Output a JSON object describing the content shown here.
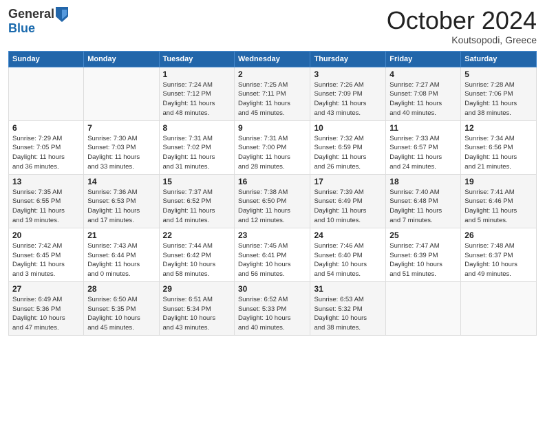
{
  "header": {
    "logo_line1": "General",
    "logo_line2": "Blue",
    "month_title": "October 2024",
    "location": "Koutsopodi, Greece"
  },
  "days_of_week": [
    "Sunday",
    "Monday",
    "Tuesday",
    "Wednesday",
    "Thursday",
    "Friday",
    "Saturday"
  ],
  "weeks": [
    [
      {
        "day": "",
        "info": ""
      },
      {
        "day": "",
        "info": ""
      },
      {
        "day": "1",
        "info": "Sunrise: 7:24 AM\nSunset: 7:12 PM\nDaylight: 11 hours\nand 48 minutes."
      },
      {
        "day": "2",
        "info": "Sunrise: 7:25 AM\nSunset: 7:11 PM\nDaylight: 11 hours\nand 45 minutes."
      },
      {
        "day": "3",
        "info": "Sunrise: 7:26 AM\nSunset: 7:09 PM\nDaylight: 11 hours\nand 43 minutes."
      },
      {
        "day": "4",
        "info": "Sunrise: 7:27 AM\nSunset: 7:08 PM\nDaylight: 11 hours\nand 40 minutes."
      },
      {
        "day": "5",
        "info": "Sunrise: 7:28 AM\nSunset: 7:06 PM\nDaylight: 11 hours\nand 38 minutes."
      }
    ],
    [
      {
        "day": "6",
        "info": "Sunrise: 7:29 AM\nSunset: 7:05 PM\nDaylight: 11 hours\nand 36 minutes."
      },
      {
        "day": "7",
        "info": "Sunrise: 7:30 AM\nSunset: 7:03 PM\nDaylight: 11 hours\nand 33 minutes."
      },
      {
        "day": "8",
        "info": "Sunrise: 7:31 AM\nSunset: 7:02 PM\nDaylight: 11 hours\nand 31 minutes."
      },
      {
        "day": "9",
        "info": "Sunrise: 7:31 AM\nSunset: 7:00 PM\nDaylight: 11 hours\nand 28 minutes."
      },
      {
        "day": "10",
        "info": "Sunrise: 7:32 AM\nSunset: 6:59 PM\nDaylight: 11 hours\nand 26 minutes."
      },
      {
        "day": "11",
        "info": "Sunrise: 7:33 AM\nSunset: 6:57 PM\nDaylight: 11 hours\nand 24 minutes."
      },
      {
        "day": "12",
        "info": "Sunrise: 7:34 AM\nSunset: 6:56 PM\nDaylight: 11 hours\nand 21 minutes."
      }
    ],
    [
      {
        "day": "13",
        "info": "Sunrise: 7:35 AM\nSunset: 6:55 PM\nDaylight: 11 hours\nand 19 minutes."
      },
      {
        "day": "14",
        "info": "Sunrise: 7:36 AM\nSunset: 6:53 PM\nDaylight: 11 hours\nand 17 minutes."
      },
      {
        "day": "15",
        "info": "Sunrise: 7:37 AM\nSunset: 6:52 PM\nDaylight: 11 hours\nand 14 minutes."
      },
      {
        "day": "16",
        "info": "Sunrise: 7:38 AM\nSunset: 6:50 PM\nDaylight: 11 hours\nand 12 minutes."
      },
      {
        "day": "17",
        "info": "Sunrise: 7:39 AM\nSunset: 6:49 PM\nDaylight: 11 hours\nand 10 minutes."
      },
      {
        "day": "18",
        "info": "Sunrise: 7:40 AM\nSunset: 6:48 PM\nDaylight: 11 hours\nand 7 minutes."
      },
      {
        "day": "19",
        "info": "Sunrise: 7:41 AM\nSunset: 6:46 PM\nDaylight: 11 hours\nand 5 minutes."
      }
    ],
    [
      {
        "day": "20",
        "info": "Sunrise: 7:42 AM\nSunset: 6:45 PM\nDaylight: 11 hours\nand 3 minutes."
      },
      {
        "day": "21",
        "info": "Sunrise: 7:43 AM\nSunset: 6:44 PM\nDaylight: 11 hours\nand 0 minutes."
      },
      {
        "day": "22",
        "info": "Sunrise: 7:44 AM\nSunset: 6:42 PM\nDaylight: 10 hours\nand 58 minutes."
      },
      {
        "day": "23",
        "info": "Sunrise: 7:45 AM\nSunset: 6:41 PM\nDaylight: 10 hours\nand 56 minutes."
      },
      {
        "day": "24",
        "info": "Sunrise: 7:46 AM\nSunset: 6:40 PM\nDaylight: 10 hours\nand 54 minutes."
      },
      {
        "day": "25",
        "info": "Sunrise: 7:47 AM\nSunset: 6:39 PM\nDaylight: 10 hours\nand 51 minutes."
      },
      {
        "day": "26",
        "info": "Sunrise: 7:48 AM\nSunset: 6:37 PM\nDaylight: 10 hours\nand 49 minutes."
      }
    ],
    [
      {
        "day": "27",
        "info": "Sunrise: 6:49 AM\nSunset: 5:36 PM\nDaylight: 10 hours\nand 47 minutes."
      },
      {
        "day": "28",
        "info": "Sunrise: 6:50 AM\nSunset: 5:35 PM\nDaylight: 10 hours\nand 45 minutes."
      },
      {
        "day": "29",
        "info": "Sunrise: 6:51 AM\nSunset: 5:34 PM\nDaylight: 10 hours\nand 43 minutes."
      },
      {
        "day": "30",
        "info": "Sunrise: 6:52 AM\nSunset: 5:33 PM\nDaylight: 10 hours\nand 40 minutes."
      },
      {
        "day": "31",
        "info": "Sunrise: 6:53 AM\nSunset: 5:32 PM\nDaylight: 10 hours\nand 38 minutes."
      },
      {
        "day": "",
        "info": ""
      },
      {
        "day": "",
        "info": ""
      }
    ]
  ]
}
